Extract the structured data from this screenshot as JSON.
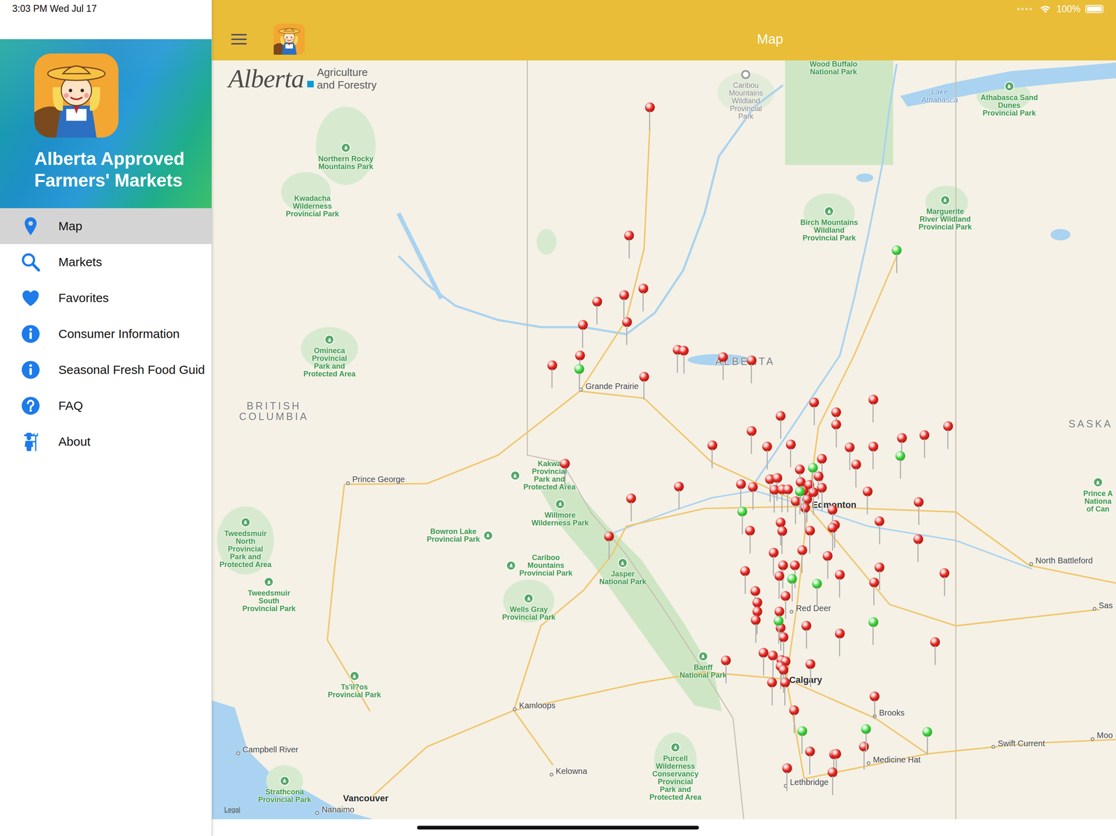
{
  "status_bar": {
    "time": "3:03 PM  Wed Jul 17",
    "battery": "100%",
    "battery_level": 1
  },
  "sidebar": {
    "app_title": "Alberta Approved Farmers' Markets",
    "items": [
      {
        "label": "Map",
        "selected": true
      },
      {
        "label": "Markets",
        "selected": false
      },
      {
        "label": "Favorites",
        "selected": false
      },
      {
        "label": "Consumer Information",
        "selected": false
      },
      {
        "label": "Seasonal Fresh Food Guid",
        "selected": false
      },
      {
        "label": "FAQ",
        "selected": false
      },
      {
        "label": "About",
        "selected": false
      }
    ]
  },
  "header": {
    "title": "Map"
  },
  "map": {
    "logo": {
      "wordmark": "Alberta",
      "subtitle": "Agriculture\nand Forestry"
    },
    "legal": "Legal",
    "labels": [
      {
        "text": "Wood Buffalo\nNational Park",
        "kind": "park"
      },
      {
        "text": "Caribou\nMountains\nWildland\nProvincial\nPark",
        "kind": "area"
      },
      {
        "text": "Lake\nAthabasca",
        "kind": "water"
      },
      {
        "text": "Athabasca Sand\nDunes\nProvincial Park",
        "kind": "park"
      },
      {
        "text": "Northern Rocky\nMountains Park",
        "kind": "park"
      },
      {
        "text": "Kwadacha\nWilderness\nProvincial Park",
        "kind": "park"
      },
      {
        "text": "Birch Mountains\nWildland\nProvincial Park",
        "kind": "park"
      },
      {
        "text": "Marguerite\nRiver Wildland\nProvincial Park",
        "kind": "park"
      },
      {
        "text": "Omineca\nProvincial\nPark and\nProtected Area",
        "kind": "park"
      },
      {
        "text": "BRITISH\nCOLUMBIA",
        "kind": "region"
      },
      {
        "text": "ALBERTA",
        "kind": "region"
      },
      {
        "text": "Grande Prairie",
        "kind": "city"
      },
      {
        "text": "SASKA",
        "kind": "region"
      },
      {
        "text": "Prince George",
        "kind": "city"
      },
      {
        "text": "Kakwa\nProvincial\nPark and\nProtected Area",
        "kind": "park"
      },
      {
        "text": "Willmore\nWilderness Park",
        "kind": "park"
      },
      {
        "text": "Bowron Lake\nProvincial Park",
        "kind": "park"
      },
      {
        "text": "Edmonton",
        "kind": "major"
      },
      {
        "text": "Tweedsmuir\nNorth\nProvincial\nPark and\nProtected Area",
        "kind": "park"
      },
      {
        "text": "Cariboo\nMountains\nProvincial Park",
        "kind": "park"
      },
      {
        "text": "Jasper\nNational Park",
        "kind": "park"
      },
      {
        "text": "Prince A\nNationa\nof Can",
        "kind": "park"
      },
      {
        "text": "North Battleford",
        "kind": "city"
      },
      {
        "text": "Tweedsmuir\nSouth\nProvincial Park",
        "kind": "park"
      },
      {
        "text": "Wells Gray\nProvincial Park",
        "kind": "park"
      },
      {
        "text": "Red Deer",
        "kind": "city"
      },
      {
        "text": "Sas",
        "kind": "city"
      },
      {
        "text": "Banff\nNational Park",
        "kind": "park"
      },
      {
        "text": "Calgary",
        "kind": "major"
      },
      {
        "text": "Ts'il?os\nProvincial Park",
        "kind": "park"
      },
      {
        "text": "Kamloops",
        "kind": "city"
      },
      {
        "text": "Brooks",
        "kind": "city"
      },
      {
        "text": "Swift Current",
        "kind": "city"
      },
      {
        "text": "Moo",
        "kind": "city"
      },
      {
        "text": "Campbell River",
        "kind": "city"
      },
      {
        "text": "Purcell\nWilderness\nConservancy\nProvincial\nPark and\nProtected Area",
        "kind": "park"
      },
      {
        "text": "Medicine Hat",
        "kind": "city"
      },
      {
        "text": "Kelowna",
        "kind": "city"
      },
      {
        "text": "Lethbridge",
        "kind": "city"
      },
      {
        "text": "Strathcona\nProvincial Park",
        "kind": "park"
      },
      {
        "text": "Vancouver",
        "kind": "major"
      },
      {
        "text": "Nanaimo",
        "kind": "city"
      }
    ],
    "pins": [
      {
        "color": "#e3261f"
      },
      {
        "color": "#e3261f"
      },
      {
        "color": "#e3261f"
      },
      {
        "color": "#e3261f"
      },
      {
        "color": "#e3261f"
      },
      {
        "color": "#e3261f"
      },
      {
        "color": "#e3261f"
      },
      {
        "color": "#e3261f"
      },
      {
        "color": "#e3261f"
      },
      {
        "color": "#e3261f"
      },
      {
        "color": "#e3261f"
      },
      {
        "color": "#e3261f"
      },
      {
        "color": "#e3261f"
      },
      {
        "color": "#e3261f"
      },
      {
        "color": "#e3261f"
      },
      {
        "color": "#e3261f"
      },
      {
        "color": "#e3261f"
      },
      {
        "color": "#e3261f"
      },
      {
        "color": "#e3261f"
      },
      {
        "color": "#e3261f"
      },
      {
        "color": "#e3261f"
      },
      {
        "color": "#e3261f"
      },
      {
        "color": "#e3261f"
      },
      {
        "color": "#e3261f"
      },
      {
        "color": "#e3261f"
      },
      {
        "color": "#e3261f"
      },
      {
        "color": "#e3261f"
      },
      {
        "color": "#e3261f"
      },
      {
        "color": "#e3261f"
      },
      {
        "color": "#e3261f"
      },
      {
        "color": "#e3261f"
      },
      {
        "color": "#e3261f"
      },
      {
        "color": "#e3261f"
      },
      {
        "color": "#e3261f"
      },
      {
        "color": "#e3261f"
      },
      {
        "color": "#e3261f"
      },
      {
        "color": "#e3261f"
      },
      {
        "color": "#e3261f"
      },
      {
        "color": "#e3261f"
      },
      {
        "color": "#e3261f"
      },
      {
        "color": "#e3261f"
      },
      {
        "color": "#e3261f"
      },
      {
        "color": "#e3261f"
      },
      {
        "color": "#e3261f"
      },
      {
        "color": "#e3261f"
      },
      {
        "color": "#e3261f"
      },
      {
        "color": "#e3261f"
      },
      {
        "color": "#e3261f"
      },
      {
        "color": "#e3261f"
      },
      {
        "color": "#e3261f"
      },
      {
        "color": "#e3261f"
      },
      {
        "color": "#e3261f"
      },
      {
        "color": "#e3261f"
      },
      {
        "color": "#e3261f"
      },
      {
        "color": "#e3261f"
      },
      {
        "color": "#e3261f"
      },
      {
        "color": "#e3261f"
      },
      {
        "color": "#e3261f"
      },
      {
        "color": "#e3261f"
      },
      {
        "color": "#e3261f"
      },
      {
        "color": "#e3261f"
      },
      {
        "color": "#e3261f"
      },
      {
        "color": "#e3261f"
      },
      {
        "color": "#e3261f"
      },
      {
        "color": "#e3261f"
      },
      {
        "color": "#e3261f"
      },
      {
        "color": "#e3261f"
      },
      {
        "color": "#e3261f"
      },
      {
        "color": "#e3261f"
      },
      {
        "color": "#e3261f"
      },
      {
        "color": "#e3261f"
      },
      {
        "color": "#e3261f"
      },
      {
        "color": "#e3261f"
      },
      {
        "color": "#e3261f"
      },
      {
        "color": "#e3261f"
      },
      {
        "color": "#e3261f"
      },
      {
        "color": "#e3261f"
      },
      {
        "color": "#e3261f"
      },
      {
        "color": "#e3261f"
      },
      {
        "color": "#e3261f"
      },
      {
        "color": "#e3261f"
      },
      {
        "color": "#e3261f"
      },
      {
        "color": "#e3261f"
      },
      {
        "color": "#e3261f"
      },
      {
        "color": "#e3261f"
      },
      {
        "color": "#e3261f"
      },
      {
        "color": "#e3261f"
      },
      {
        "color": "#e3261f"
      },
      {
        "color": "#e3261f"
      },
      {
        "color": "#e3261f"
      },
      {
        "color": "#e3261f"
      },
      {
        "color": "#e3261f"
      },
      {
        "color": "#e3261f"
      },
      {
        "color": "#e3261f"
      },
      {
        "color": "#e3261f"
      },
      {
        "color": "#e3261f"
      },
      {
        "color": "#e3261f"
      },
      {
        "color": "#e3261f"
      },
      {
        "color": "#e3261f"
      },
      {
        "color": "#e3261f"
      },
      {
        "color": "#e3261f"
      },
      {
        "color": "#e3261f"
      },
      {
        "color": "#3fd43b"
      },
      {
        "color": "#3fd43b"
      },
      {
        "color": "#3fd43b"
      },
      {
        "color": "#3fd43b"
      },
      {
        "color": "#3fd43b"
      },
      {
        "color": "#3fd43b"
      },
      {
        "color": "#3fd43b"
      },
      {
        "color": "#3fd43b"
      },
      {
        "color": "#3fd43b"
      },
      {
        "color": "#3fd43b"
      },
      {
        "color": "#3fd43b"
      },
      {
        "color": "#3fd43b"
      },
      {
        "color": "#3fd43b"
      }
    ]
  }
}
